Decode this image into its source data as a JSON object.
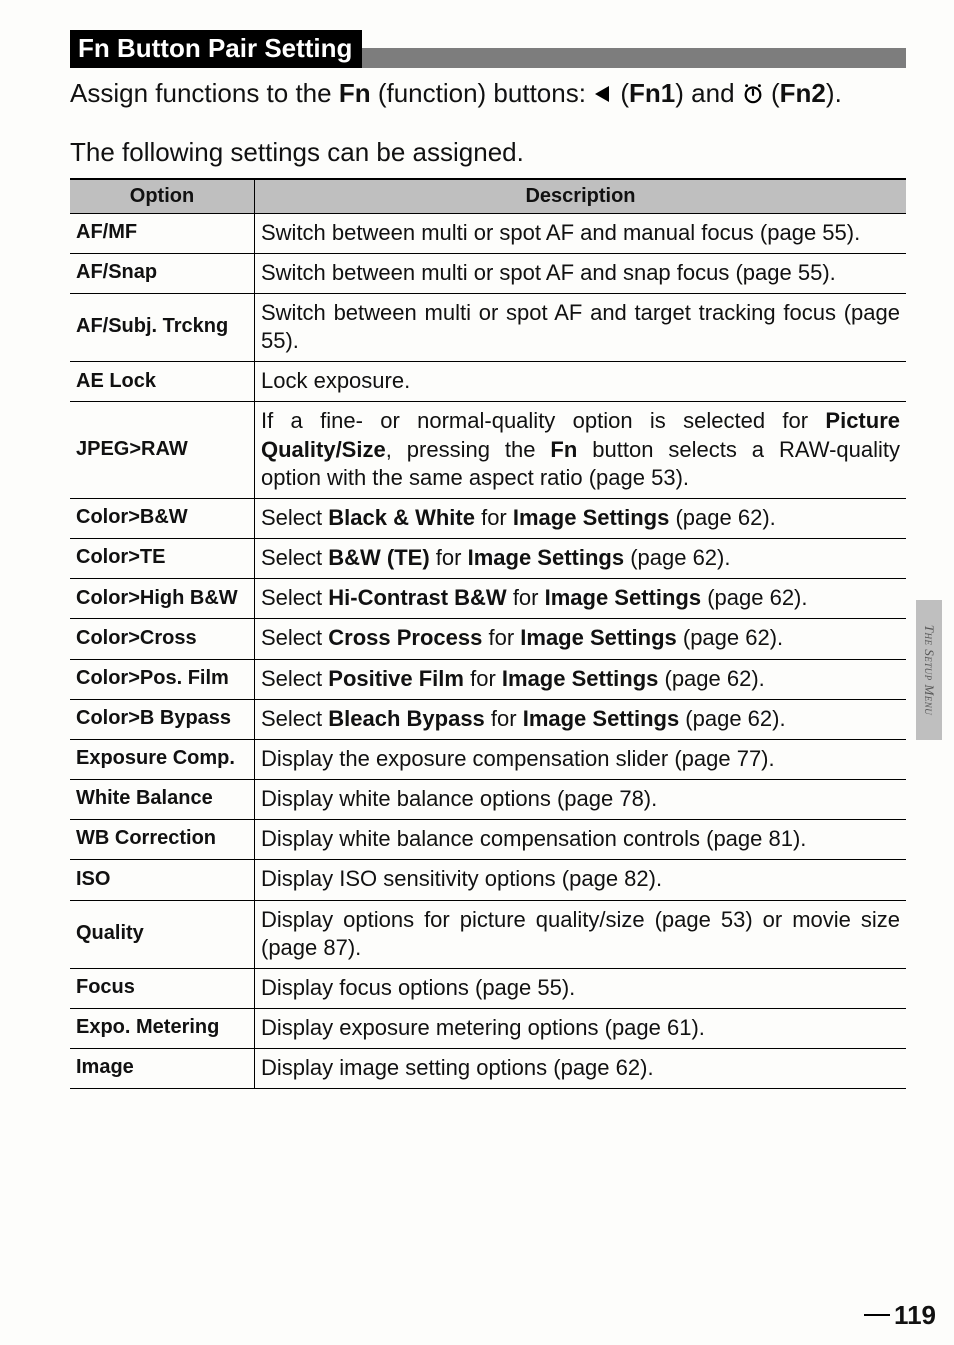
{
  "heading": "Fn Button Pair Setting",
  "intro_parts": {
    "pre": "Assign functions to the ",
    "fn": "Fn",
    "mid": " (function) buttons: ",
    "fn1": "Fn1",
    "and": ") and ",
    "fn2": "Fn2",
    "post": ")."
  },
  "subintro": "The following settings can be assigned.",
  "table": {
    "headers": {
      "option": "Option",
      "description": "Description"
    },
    "rows": [
      {
        "option": "AF/MF",
        "desc_html": "Switch between multi or spot AF and manual focus (page 55)."
      },
      {
        "option": "AF/Snap",
        "desc_html": "Switch between multi or spot AF and snap focus (page 55)."
      },
      {
        "option": "AF/Subj. Trckng",
        "desc_html": "Switch between multi or spot AF and target tracking focus (page 55)."
      },
      {
        "option": "AE Lock",
        "desc_html": "Lock exposure."
      },
      {
        "option": "JPEG>RAW",
        "desc_html": "If a fine- or normal-quality option is selected for <span class=\"b\">Picture Quality/Size</span>, pressing the <span class=\"b\">Fn</span> button selects a RAW-quality option with the same aspect ratio (page 53)."
      },
      {
        "option": "Color>B&W",
        "desc_html": "Select <span class=\"b\">Black & White</span> for <span class=\"b\">Image Settings</span> (page 62)."
      },
      {
        "option": "Color>TE",
        "desc_html": "Select <span class=\"b\">B&W (TE)</span> for <span class=\"b\">Image Settings</span> (page 62)."
      },
      {
        "option": "Color>High B&W",
        "desc_html": "Select <span class=\"b\">Hi-Contrast B&W</span> for <span class=\"b\">Image Settings</span> (page 62)."
      },
      {
        "option": "Color>Cross",
        "desc_html": "Select <span class=\"b\">Cross Process</span> for <span class=\"b\">Image Settings</span> (page 62)."
      },
      {
        "option": "Color>Pos. Film",
        "desc_html": "Select <span class=\"b\">Positive Film</span> for <span class=\"b\">Image Settings</span> (page 62)."
      },
      {
        "option": "Color>B Bypass",
        "desc_html": "Select <span class=\"b\">Bleach Bypass</span> for <span class=\"b\">Image Settings</span> (page 62)."
      },
      {
        "option": "Exposure Comp.",
        "desc_html": "Display the exposure compensation slider (page 77)."
      },
      {
        "option": "White Balance",
        "desc_html": "Display white balance options (page 78)."
      },
      {
        "option": "WB Correction",
        "desc_html": "Display white balance compensation controls (page 81)."
      },
      {
        "option": "ISO",
        "desc_html": "Display ISO sensitivity options (page 82)."
      },
      {
        "option": "Quality",
        "desc_html": "Display options for picture quality/size (page 53) or movie size (page 87)."
      },
      {
        "option": "Focus",
        "desc_html": "Display focus options (page 55)."
      },
      {
        "option": "Expo. Metering",
        "desc_html": "Display exposure metering options (page 61)."
      },
      {
        "option": "Image",
        "desc_html": "Display image setting options (page 62)."
      }
    ]
  },
  "side_tab": "The Setup Menu",
  "page_number": "119"
}
